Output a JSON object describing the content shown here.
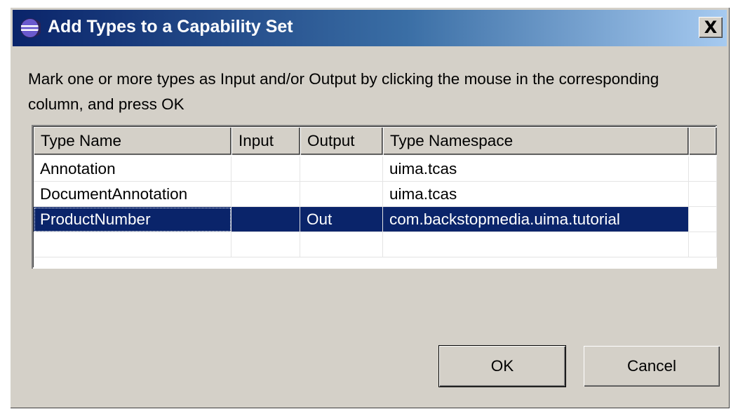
{
  "dialog": {
    "title": "Add Types to a Capability Set",
    "icon": "eclipse-icon",
    "close_label": "X",
    "instructions": "Mark one or more types as Input and/or Output by clicking the mouse in the corresponding column, and press OK"
  },
  "table": {
    "columns": [
      "Type Name",
      "Input",
      "Output",
      "Type Namespace"
    ],
    "rows": [
      {
        "name": "Annotation",
        "input": "",
        "output": "",
        "namespace": "uima.tcas",
        "selected": false
      },
      {
        "name": "DocumentAnnotation",
        "input": "",
        "output": "",
        "namespace": "uima.tcas",
        "selected": false
      },
      {
        "name": "ProductNumber",
        "input": "",
        "output": "Out",
        "namespace": "com.backstopmedia.uima.tutorial",
        "selected": true
      }
    ]
  },
  "buttons": {
    "ok": "OK",
    "cancel": "Cancel"
  },
  "colors": {
    "selection": "#0a246a",
    "dialog_bg": "#d4d0c8"
  }
}
